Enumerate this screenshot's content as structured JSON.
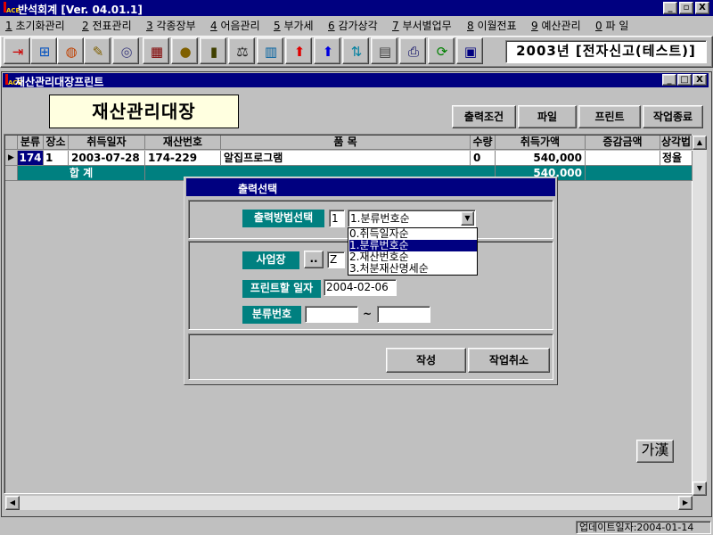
{
  "app": {
    "title": "반석회계 [Ver. 04.01.1]",
    "logo": "ACE",
    "window_buttons": [
      "_",
      "▫",
      "X"
    ]
  },
  "menu": [
    {
      "key": "1",
      "label": "초기화관리"
    },
    {
      "key": "2",
      "label": "전표관리"
    },
    {
      "key": "3",
      "label": "각종장부"
    },
    {
      "key": "4",
      "label": "어음관리"
    },
    {
      "key": "5",
      "label": "부가세"
    },
    {
      "key": "6",
      "label": "감가상각"
    },
    {
      "key": "7",
      "label": "부서별업무"
    },
    {
      "key": "8",
      "label": "이월전표"
    },
    {
      "key": "9",
      "label": "예산관리"
    },
    {
      "key": "0",
      "label": "파 일"
    }
  ],
  "toolbar_icons": [
    "exit-icon",
    "tree-icon",
    "globe-icon",
    "pencil-icon",
    "disc-icon",
    "calculator-icon",
    "coin-icon",
    "book-icon",
    "scale-icon",
    "grid-icon",
    "arrow-up-red-icon",
    "arrow-up-blue-icon",
    "sort-icon",
    "spreadsheet-icon",
    "printer-icon",
    "refresh-icon",
    "window-icon"
  ],
  "company": "2003년  [전자신고(테스트)]",
  "child": {
    "title": "재산관리대장프린트",
    "window_buttons": [
      "_",
      "□",
      "X"
    ],
    "heading": "재산관리대장",
    "buttons": {
      "output_condition": "출력조건",
      "file": "파일",
      "print": "프린트",
      "end": "작업종료"
    }
  },
  "table": {
    "headers": [
      "분류",
      "장소",
      "취득일자",
      "재산번호",
      "품     목",
      "수량",
      "취득가액",
      "증감금액",
      "상각법"
    ],
    "rows": [
      [
        "174",
        "1",
        "2003-07-28",
        "174-229",
        "알집프로그램",
        "0",
        "540,000",
        "",
        "정율"
      ]
    ],
    "total_label": "합    계",
    "total_amount": "540,000"
  },
  "dialog": {
    "title": "출력선택",
    "method_label": "출력방법선택",
    "method_code": "1",
    "method_selected": "1.분류번호순",
    "options": [
      "0.취득일자순",
      "1.분류번호순",
      "2.재산번호순",
      "3.처분재산명세순"
    ],
    "site_label": "사업장",
    "site_btn": "..",
    "site_value": "Z",
    "print_date_label": "프린트할 일자",
    "print_date": "2004-02-06",
    "class_label": "분류번호",
    "class_from": "",
    "class_to": "",
    "tilde": "~",
    "create_btn": "작성",
    "cancel_btn": "작업취소"
  },
  "ime_button": "가漢",
  "status": "업데이트일자:2004-01-14"
}
